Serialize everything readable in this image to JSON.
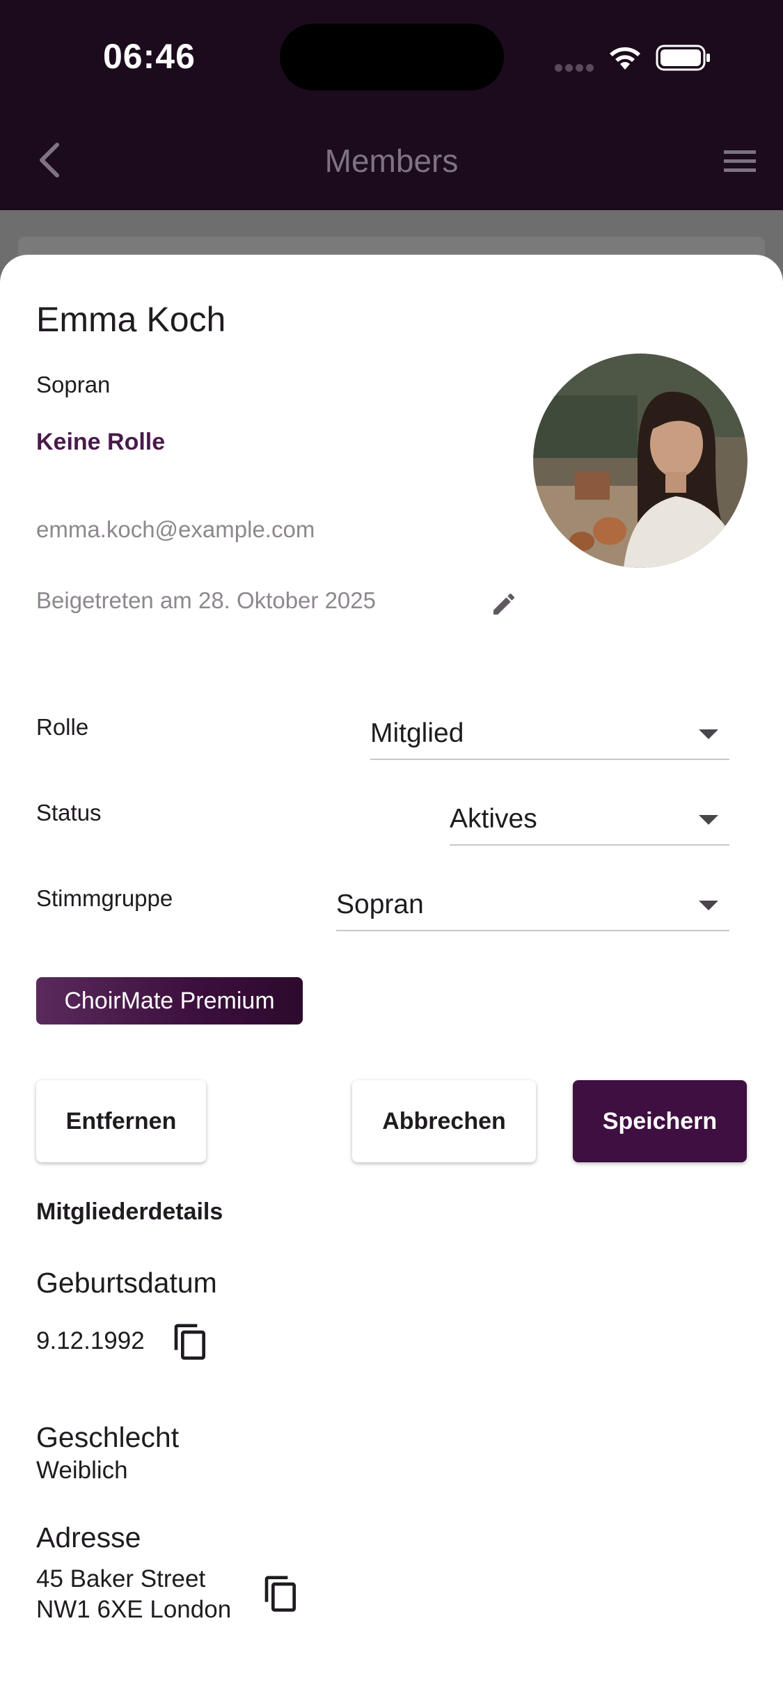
{
  "status_bar": {
    "time": "06:46",
    "icons": [
      "signal-dots-icon",
      "wifi-icon",
      "battery-icon"
    ]
  },
  "app_bar": {
    "title": "Members",
    "back_icon": "chevron-left-icon",
    "menu_icon": "hamburger-menu-icon"
  },
  "member": {
    "name": "Emma Koch",
    "voice": "Sopran",
    "role_link": "Keine Rolle",
    "email": "emma.koch@example.com",
    "joined": "Beigetreten am 28. Oktober 2025",
    "edit_icon": "pencil-icon",
    "avatar": "profile-photo"
  },
  "fields": [
    {
      "label": "Rolle",
      "value": "Mitglied"
    },
    {
      "label": "Status",
      "value": "Aktives"
    },
    {
      "label": "Stimmgruppe",
      "value": "Sopran"
    }
  ],
  "premium_badge": "ChoirMate Premium",
  "buttons": {
    "remove": "Entfernen",
    "cancel": "Abbrechen",
    "save": "Speichern"
  },
  "details": {
    "section_title": "Mitgliederdetails",
    "birthdate_label": "Geburtsdatum",
    "birthdate_value": "9.12.1992",
    "gender_label": "Geschlecht",
    "gender_value": "Weiblich",
    "address_label": "Adresse",
    "address_line1": "45 Baker Street",
    "address_line2": "NW1 6XE London",
    "copy_icon": "copy-icon"
  },
  "colors": {
    "header_bg": "#1c0b1d",
    "accent": "#3e0f40",
    "role_link": "#4a1a4b"
  }
}
